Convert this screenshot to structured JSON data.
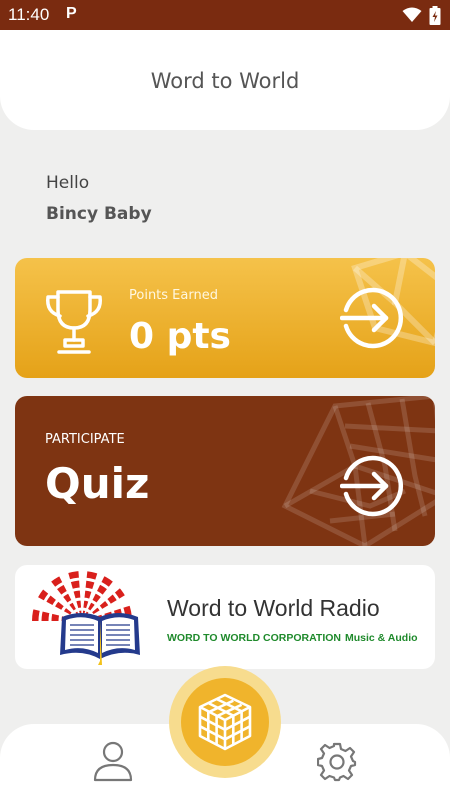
{
  "status_bar": {
    "time": "11:40",
    "notification_glyph": "P",
    "icons": [
      "wifi-icon",
      "battery-icon"
    ]
  },
  "header": {
    "title": "Word to World"
  },
  "greeting": {
    "hello": "Hello",
    "name": "Bincy Baby"
  },
  "points_card": {
    "label": "Points Earned",
    "value": "0 pts",
    "icon": "trophy-icon",
    "action_icon": "arrow-circle-icon"
  },
  "quiz_card": {
    "overline": "PARTICIPATE",
    "title": "Quiz",
    "action_icon": "arrow-circle-icon"
  },
  "radio_card": {
    "title": "Word to World Radio",
    "corporation": "WORD TO WORLD CORPORATION",
    "tagline": "Music & Audio",
    "logo": "word-to-world-logo"
  },
  "bottom_nav": {
    "items": [
      "profile-icon",
      "cube-icon",
      "gear-icon"
    ]
  },
  "colors": {
    "status_bar": "#7a2b10",
    "points_card": "#f0b030",
    "quiz_card": "#7e3412",
    "fab": "#f0b42c",
    "green_text": "#1f8a2c"
  }
}
